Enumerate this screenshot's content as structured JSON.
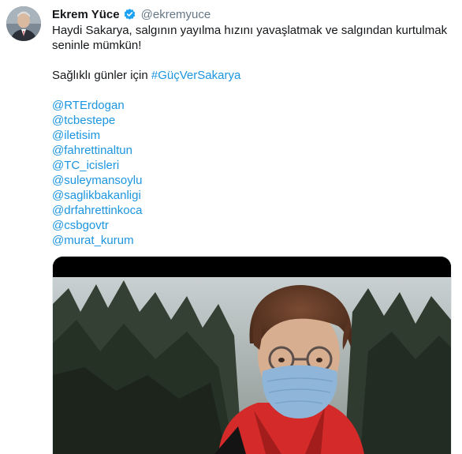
{
  "tweet": {
    "author_name": "Ekrem Yüce",
    "author_handle": "@ekremyuce",
    "text_line1": "Haydi Sakarya, salgının yayılma hızını yavaşlatmak ve salgından kurtulmak",
    "text_line2": "seninle mümkün!",
    "text_line3_prefix": "Sağlıklı günler için ",
    "hashtag": "#GüçVerSakarya",
    "mentions": [
      "@RTErdogan",
      "@tcbestepe",
      "@iletisim",
      "@fahrettinaltun",
      "@TC_icisleri",
      "@suleymansoylu",
      "@saglikbakanligi",
      "@drfahrettinkoca",
      "@csbgovtr",
      "@murat_kurum"
    ]
  },
  "colors": {
    "link": "#1b95e0",
    "verified": "#1da1f2",
    "muted": "#657786"
  },
  "icons": {
    "verified": "verified-badge-icon"
  }
}
